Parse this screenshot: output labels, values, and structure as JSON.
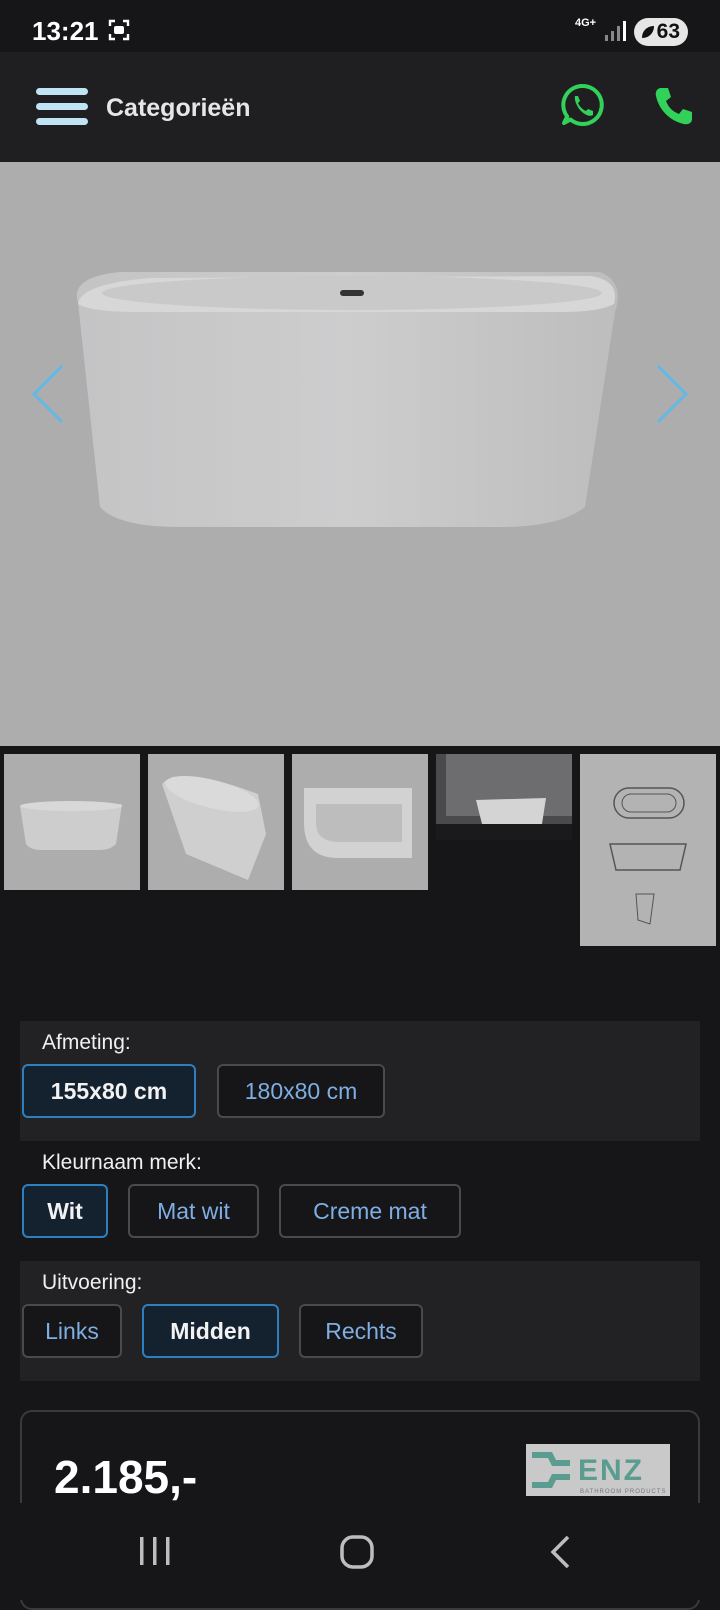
{
  "status": {
    "time": "13:21",
    "network": "4G+",
    "battery": "63"
  },
  "header": {
    "menu_icon": "hamburger-icon",
    "title": "Categorieën",
    "whatsapp_icon": "whatsapp-icon",
    "phone_icon": "phone-icon"
  },
  "gallery": {
    "prev_icon": "chevron-left-icon",
    "next_icon": "chevron-right-icon",
    "thumbnails": [
      "bathtub-front",
      "bathtub-angle",
      "bathtub-top",
      "bathroom-scene",
      "technical-drawing"
    ]
  },
  "options": {
    "size": {
      "label": "Afmeting:",
      "choices": [
        "155x80 cm",
        "180x80 cm"
      ],
      "selected": "155x80 cm"
    },
    "color": {
      "label": "Kleurnaam merk:",
      "choices": [
        "Wit",
        "Mat wit",
        "Creme mat"
      ],
      "selected": "Wit"
    },
    "variant": {
      "label": "Uitvoering:",
      "choices": [
        "Links",
        "Midden",
        "Rechts"
      ],
      "selected": "Midden"
    }
  },
  "product": {
    "price": "2.185,-",
    "brand": "ENZ",
    "brand_sub": "BATHROOM PRODUCTS"
  },
  "colors": {
    "accent": "#2d7fbf",
    "link": "#7eaee3",
    "whatsapp": "#32d25a",
    "background": "#161618"
  }
}
